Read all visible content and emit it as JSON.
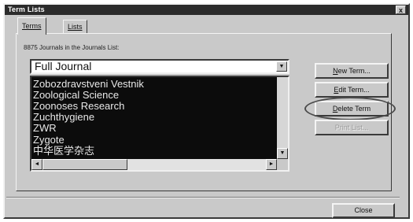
{
  "window": {
    "title": "Term Lists",
    "close_glyph": "x"
  },
  "tabs": [
    {
      "label": "Terms",
      "active": true
    },
    {
      "label": "Lists",
      "active": false
    }
  ],
  "panel": {
    "caption": "8875 Journals in the Journals List:"
  },
  "list_selector": {
    "value": "Full Journal",
    "dropdown_glyph": "▼"
  },
  "journals": [
    "Zobozdravstveni Vestnik",
    "Zoological Science",
    "Zoonoses Research",
    "Zuchthygiene",
    "ZWR",
    "Zygote",
    "中华医学杂志"
  ],
  "scrollbar_glyphs": {
    "up": "▲",
    "down": "▼",
    "left": "◄",
    "right": "►"
  },
  "buttons": {
    "new_term": {
      "mnemonic": "N",
      "rest": "ew Term..."
    },
    "edit_term": {
      "mnemonic": "E",
      "rest": "dit Term..."
    },
    "delete_term": {
      "mnemonic": "D",
      "rest": "elete Term"
    },
    "print_list": {
      "label": "Print List..."
    },
    "close": {
      "label": "Close"
    }
  }
}
